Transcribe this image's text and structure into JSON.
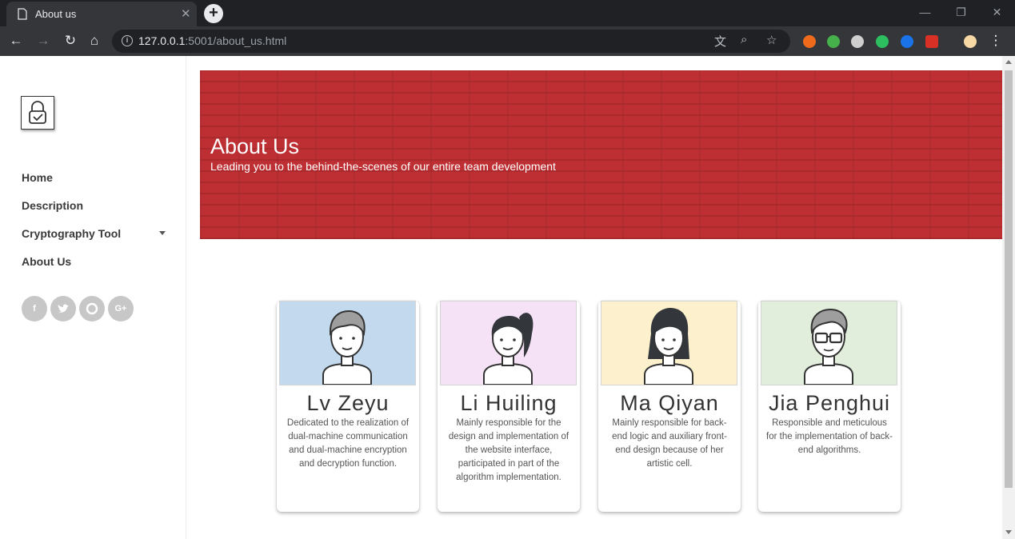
{
  "browser": {
    "tab_title": "About us",
    "url_host": "127.0.0.1",
    "url_rest": ":5001/about_us.html"
  },
  "sidebar": {
    "nav": [
      {
        "label": "Home"
      },
      {
        "label": "Description"
      },
      {
        "label": "Cryptography Tool"
      },
      {
        "label": "About Us"
      }
    ],
    "social": [
      "f",
      "t",
      "gh",
      "G+"
    ]
  },
  "hero": {
    "title": "About Us",
    "subtitle": "Leading you to the behind-the-scenes of our entire team development",
    "color": "#be2f33"
  },
  "team": [
    {
      "name": "Lv Zeyu",
      "desc": "Dedicated to the realization of dual-machine communication and dual-machine encryption and decryption function.",
      "bg": "#c3d9ee",
      "avatar": "man-avatar"
    },
    {
      "name": "Li Huiling",
      "desc": "Mainly responsible for the design and implementation of the website interface, participated in part of the algorithm implementation.",
      "bg": "#f6e2f6",
      "avatar": "ponytail-woman-avatar"
    },
    {
      "name": "Ma Qiyan",
      "desc": "Mainly responsible for back-end logic and auxiliary front-end design because of her artistic cell.",
      "bg": "#fdf1cd",
      "avatar": "long-hair-woman-avatar"
    },
    {
      "name": "Jia Penghui",
      "desc": "Responsible and meticulous for the implementation of back-end algorithms.",
      "bg": "#e2eedc",
      "avatar": "glasses-man-avatar"
    }
  ]
}
